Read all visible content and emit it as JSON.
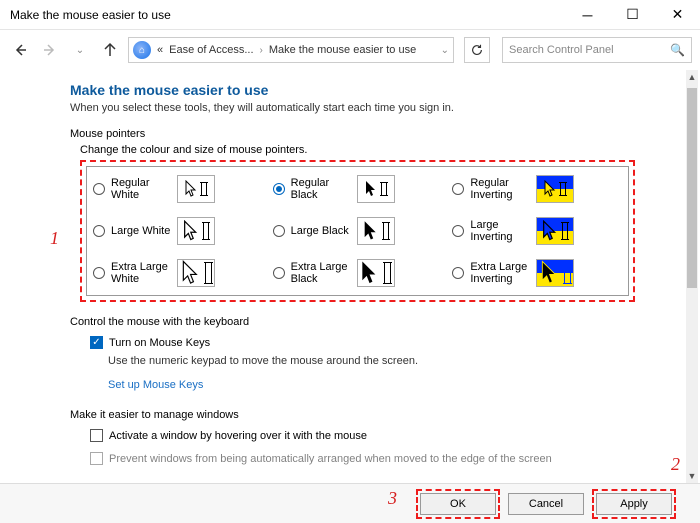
{
  "window": {
    "title": "Make the mouse easier to use"
  },
  "breadcrumb": {
    "prefix": "«",
    "seg1": "Ease of Access...",
    "seg2": "Make the mouse easier to use"
  },
  "search": {
    "placeholder": "Search Control Panel"
  },
  "heading": "Make the mouse easier to use",
  "subheading": "When you select these tools, they will automatically start each time you sign in.",
  "pointers_section": "Mouse pointers",
  "pointers_sublabel": "Change the colour and size of mouse pointers.",
  "pointer_options": {
    "regular_white": "Regular White",
    "regular_black": "Regular Black",
    "regular_inverting": "Regular Inverting",
    "large_white": "Large White",
    "large_black": "Large Black",
    "large_inverting": "Large Inverting",
    "xlarge_white": "Extra Large White",
    "xlarge_black": "Extra Large Black",
    "xlarge_inverting": "Extra Large Inverting"
  },
  "selected_pointer": "regular_black",
  "keyboard_section": "Control the mouse with the keyboard",
  "mouse_keys_label": "Turn on Mouse Keys",
  "mouse_keys_checked": true,
  "mouse_keys_desc": "Use the numeric keypad to move the mouse around the screen.",
  "setup_link": "Set up Mouse Keys",
  "windows_section": "Make it easier to manage windows",
  "hover_label": "Activate a window by hovering over it with the mouse",
  "hover_checked": false,
  "snap_label": "Prevent windows from being automatically arranged when moved to the edge of the screen",
  "snap_checked": false,
  "buttons": {
    "ok": "OK",
    "cancel": "Cancel",
    "apply": "Apply"
  },
  "annotations": {
    "a1": "1",
    "a2": "2",
    "a3": "3"
  }
}
